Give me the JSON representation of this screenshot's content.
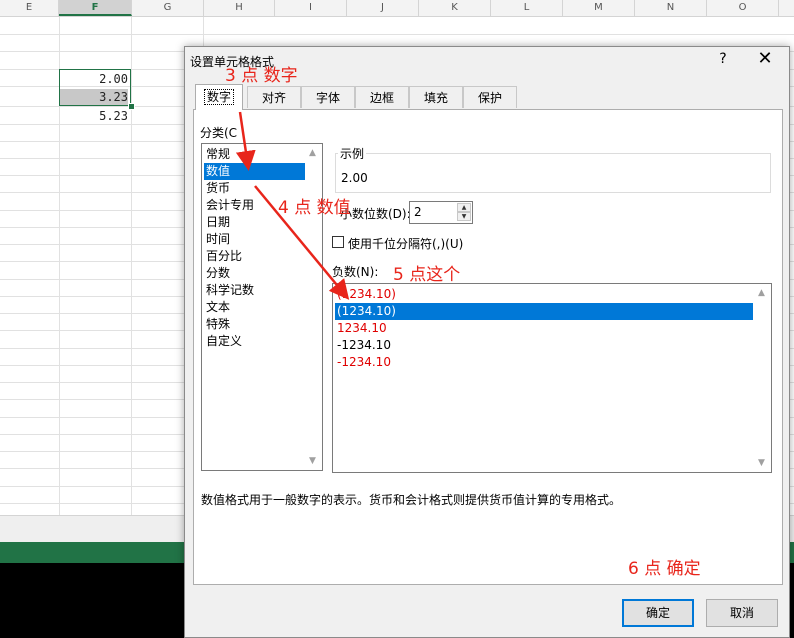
{
  "sheet": {
    "columns": [
      "E",
      "F",
      "G",
      "H",
      "I",
      "J",
      "K",
      "L",
      "M",
      "N",
      "O"
    ],
    "selected_column": "F",
    "cells": [
      "2.00",
      "3.23",
      "5.23"
    ]
  },
  "dialog": {
    "title": "设置单元格格式",
    "help": "?",
    "close": "✕",
    "tabs": [
      "数字",
      "对齐",
      "字体",
      "边框",
      "填充",
      "保护"
    ],
    "active_tab": "数字",
    "category_label": "分类(C",
    "categories": [
      "常规",
      "数值",
      "货币",
      "会计专用",
      "日期",
      "时间",
      "百分比",
      "分数",
      "科学记数",
      "文本",
      "特殊",
      "自定义"
    ],
    "selected_category": "数值",
    "sample_label": "示例",
    "sample_value": "2.00",
    "decimal_label": "小数位数(D):",
    "decimal_value": "2",
    "thousands_label": "使用千位分隔符(,)(U)",
    "negative_label": "负数(N):",
    "negative_options": [
      "(1234.10)",
      "(1234.10)",
      "1234.10",
      "-1234.10",
      "-1234.10"
    ],
    "description": "数值格式用于一般数字的表示。货币和会计格式则提供货币值计算的专用格式。",
    "ok": "确定",
    "cancel": "取消"
  },
  "annotations": {
    "a3": "3 点 数字",
    "a4": "4 点 数值",
    "a5": "5 点这个",
    "a6": "6 点 确定",
    "color": "#e8251b"
  },
  "colors": {
    "excel_green": "#217346",
    "selection_blue": "#0078d7",
    "negative_red": "#e00000"
  }
}
